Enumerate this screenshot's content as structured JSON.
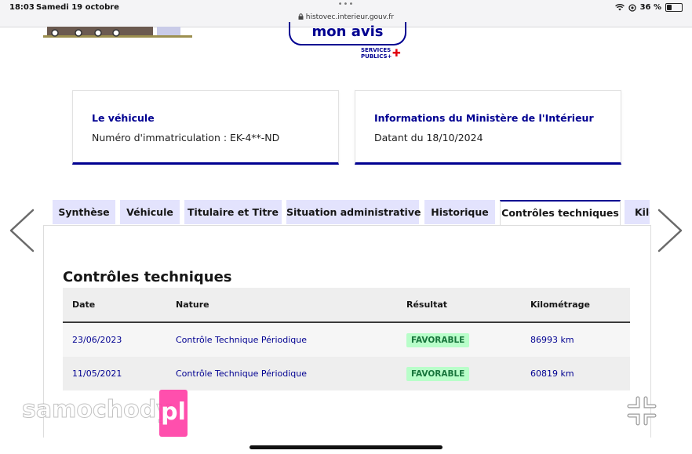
{
  "status_bar": {
    "time": "18:03",
    "date": "Samedi 19 octobre",
    "url": "histovec.interieur.gouv.fr",
    "battery": "36 %",
    "battery_level": 0.36,
    "icons": [
      "wifi-icon",
      "focus-icon",
      "battery-icon",
      "lock-icon",
      "more-dots-icon"
    ]
  },
  "header": {
    "avis_button": "mon avis",
    "services_publics_line1": "SERVICES",
    "services_publics_line2": "PUBLICS+"
  },
  "cards": [
    {
      "title": "Le véhicule",
      "text": "Numéro d'immatriculation : EK-4**-ND"
    },
    {
      "title": "Informations du Ministère de l'Intérieur",
      "text": "Datant du 18/10/2024"
    }
  ],
  "tabs": [
    {
      "label": "Synthèse",
      "active": false
    },
    {
      "label": "Véhicule",
      "active": false
    },
    {
      "label": "Titulaire et Titre",
      "active": false
    },
    {
      "label": "Situation administrative",
      "active": false
    },
    {
      "label": "Historique",
      "active": false
    },
    {
      "label": "Contrôles techniques",
      "active": true
    },
    {
      "label": "Kilo",
      "active": false
    }
  ],
  "section": {
    "title": "Contrôles techniques",
    "columns": [
      "Date",
      "Nature",
      "Résultat",
      "Kilométrage"
    ],
    "rows": [
      {
        "date": "23/06/2023",
        "nature": "Contrôle Technique Périodique",
        "result": "FAVORABLE",
        "km": "86993 km"
      },
      {
        "date": "11/05/2021",
        "nature": "Contrôle Technique Périodique",
        "result": "FAVORABLE",
        "km": "60819 km"
      }
    ]
  },
  "watermark": {
    "text": "samochody",
    "badge": "pl"
  },
  "colors": {
    "primary": "#000091",
    "tab_bg": "#e3e3fd",
    "badge_bg": "#b8fec9",
    "badge_text": "#18753c",
    "watermark_pink": "#ff3da5"
  }
}
